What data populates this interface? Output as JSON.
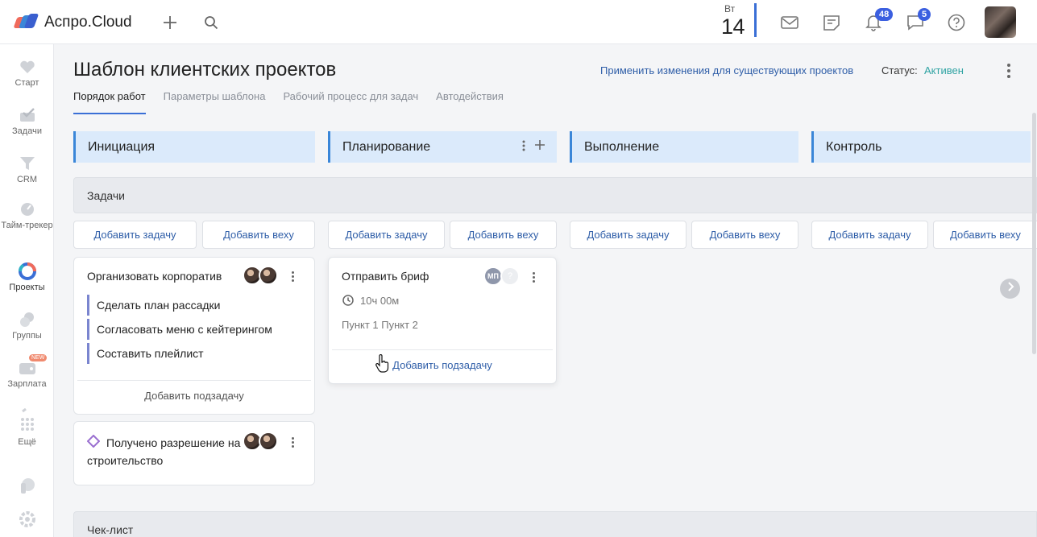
{
  "app": {
    "name": "Аспро.Cloud"
  },
  "topbar": {
    "date_dow": "Вт",
    "date_day": "14",
    "notifications_count": "48",
    "messages_count": "5",
    "icons": [
      "plus-icon",
      "search-icon",
      "mail-icon",
      "notes-icon",
      "bell-icon",
      "chat-icon",
      "help-icon"
    ]
  },
  "sidebar": {
    "items": [
      {
        "label": "Старт",
        "icon": "heart-icon"
      },
      {
        "label": "Задачи",
        "icon": "tasks-icon"
      },
      {
        "label": "CRM",
        "icon": "funnel-icon"
      },
      {
        "label": "Тайм-трекер",
        "icon": "timer-icon"
      },
      {
        "label": "Проекты",
        "icon": "projects-icon"
      },
      {
        "label": "Группы",
        "icon": "groups-icon"
      },
      {
        "label": "Зарплата",
        "icon": "wallet-icon",
        "badge": "NEW"
      },
      {
        "label": "Ещё",
        "icon": "grid-icon"
      }
    ]
  },
  "header": {
    "title": "Шаблон клиентских проектов",
    "apply_link": "Применить изменения для существующих проектов",
    "status_label": "Статус:",
    "status_value": "Активен"
  },
  "tabs": [
    {
      "label": "Порядок работ",
      "active": true
    },
    {
      "label": "Параметры шаблона",
      "active": false
    },
    {
      "label": "Рабочий процесс для задач",
      "active": false
    },
    {
      "label": "Автодействия",
      "active": false
    }
  ],
  "columns": [
    {
      "title": "Инициация"
    },
    {
      "title": "Планирование"
    },
    {
      "title": "Выполнение"
    },
    {
      "title": "Контроль"
    }
  ],
  "sections": {
    "tasks": "Задачи",
    "checklist": "Чек-лист"
  },
  "buttons": {
    "add_task": "Добавить задачу",
    "add_milestone": "Добавить веху",
    "add_subtask": "Добавить подзадачу"
  },
  "cards": {
    "corporate": {
      "title": "Организовать корпоратив",
      "subtasks": [
        "Сделать план рассадки",
        "Согласовать меню с кейтерингом",
        "Составить плейлист"
      ]
    },
    "permit": {
      "title": "Получено разрешение на строительство"
    },
    "brief": {
      "title": "Отправить бриф",
      "assignee_initials": "МП",
      "unknown_assignee": "?",
      "time": "10ч 00м",
      "checklist": "Пункт 1 Пункт 2"
    }
  },
  "colors": {
    "accent": "#3a6fd6",
    "link": "#2f5ea8",
    "status_active": "#2fa3a3",
    "column_header": "#dbeafb"
  }
}
